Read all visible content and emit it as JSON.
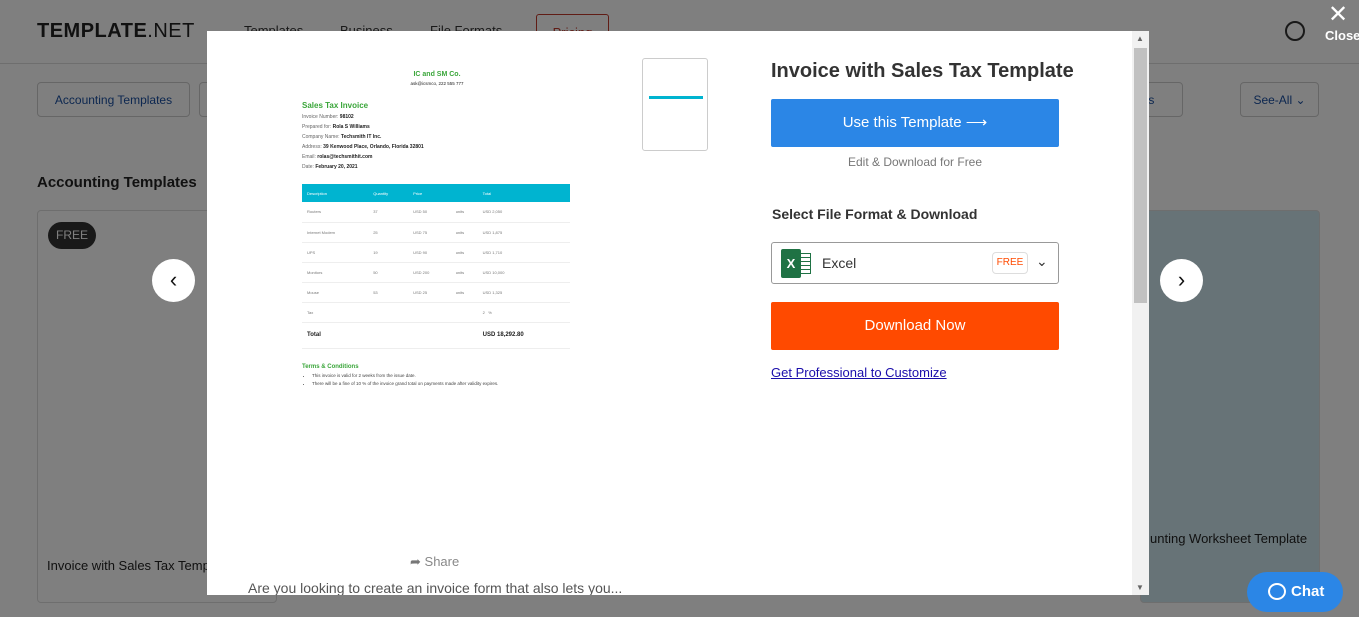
{
  "header": {
    "logo_bold": "TEMPLATE",
    "logo_light": ".NET",
    "nav": [
      "Templates",
      "Business",
      "File Formats"
    ],
    "pricing": "Pricing"
  },
  "categories": {
    "first": "Accounting Templates",
    "partial": "rts",
    "see_all": "See-All"
  },
  "section_title": "Accounting Templates",
  "cards": [
    {
      "badge": "FREE",
      "title": "Invoice with Sales Tax Templ"
    },
    {
      "title": "unting Worksheet Template"
    }
  ],
  "overlay": {
    "close_label": "Close",
    "prev_icon": "chevron-left-icon",
    "next_icon": "chevron-right-icon"
  },
  "chat": {
    "label": "Chat"
  },
  "modal": {
    "title": "Invoice with Sales Tax Template",
    "use_button": "Use this Template ⟶",
    "edit_label": "Edit & Download for Free",
    "select_label": "Select File Format & Download",
    "format": {
      "value": "Excel",
      "badge": "FREE"
    },
    "download_button": "Download Now",
    "pro_link": "Get Professional to Customize",
    "share_label": "Share",
    "description": "Are you looking to create an invoice form that also lets you...",
    "colors": {
      "primary": "#2b86e6",
      "download": "#ff4a00",
      "doc_accent": "#00b4d0",
      "doc_heading": "#3aa63a"
    },
    "preview": {
      "company": "IC and SM Co.",
      "contact": "ask@icsmco, 222 555 777",
      "heading": "Sales Tax Invoice",
      "fields": [
        {
          "label": "Invoice Number:",
          "value": "98102"
        },
        {
          "label": "Prepared for:",
          "value": "Rola S Williams"
        },
        {
          "label": "Company Name:",
          "value": "Techsmith IT Inc."
        },
        {
          "label": "Address:",
          "value": "39 Kenwood Place, Orlando, Florida 32801"
        },
        {
          "label": "Email:",
          "value": "rolas@techsmithit.com"
        },
        {
          "label": "Date:",
          "value": "February 20, 2021"
        }
      ],
      "columns": [
        "Description",
        "Quantity",
        "Price",
        "",
        "Total"
      ],
      "rows": [
        [
          "Routers",
          "37",
          "USD 50",
          "units",
          "USD 2,050"
        ],
        [
          "Internet Modem",
          "25",
          "USD 75",
          "units",
          "USD 1,875"
        ],
        [
          "UPS",
          "19",
          "USD 90",
          "units",
          "USD 1,710"
        ],
        [
          "Monitors",
          "50",
          "USD 200",
          "units",
          "USD 10,000"
        ],
        [
          "Mouse",
          "53",
          "USD 25",
          "units",
          "USD 1,325"
        ]
      ],
      "tax": [
        "Tax",
        "2",
        "%"
      ],
      "total": [
        "Total",
        "USD 18,292.80"
      ],
      "terms_heading": "Terms & Conditions",
      "terms": [
        "This invoice is valid for 2 weeks from the issue date.",
        "There will be a fine of 10 % of the invoice grand total on payments made after validity expires."
      ]
    }
  }
}
